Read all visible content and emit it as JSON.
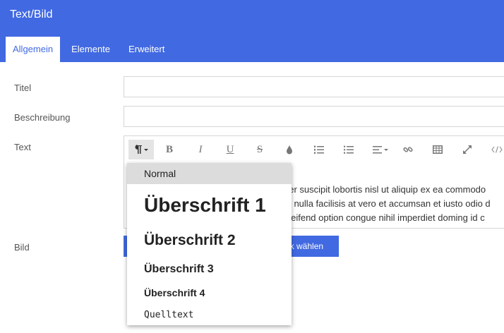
{
  "header": {
    "title": "Text/Bild"
  },
  "tabs": [
    {
      "label": "Allgemein",
      "active": true
    },
    {
      "label": "Elemente",
      "active": false
    },
    {
      "label": "Erweitert",
      "active": false
    }
  ],
  "form": {
    "title_label": "Titel",
    "description_label": "Beschreibung",
    "text_label": "Text",
    "image_label": "Bild"
  },
  "editor": {
    "toolbar": [
      "paragraph-style-icon",
      "bold-icon",
      "italic-icon",
      "underline-icon",
      "strikethrough-icon",
      "color-drop-icon",
      "ordered-list-icon",
      "unordered-list-icon",
      "align-icon",
      "link-icon",
      "table-icon",
      "fullscreen-icon",
      "code-view-icon"
    ],
    "content_lines": [
      "per suscipit lobortis nisl ut aliquip ex ea commodo",
      "at nulla facilisis at vero et accumsan et iusto odio d",
      "eleifend option congue nihil imperdiet doming id c"
    ]
  },
  "media_button": {
    "label": "ek wählen"
  },
  "style_menu": {
    "items": [
      "Normal",
      "Überschrift 1",
      "Überschrift 2",
      "Überschrift 3",
      "Überschrift 4",
      "Quelltext"
    ],
    "selected": "Normal"
  },
  "colors": {
    "accent": "#4169e1",
    "menu_highlight": "#dcdcdc"
  }
}
